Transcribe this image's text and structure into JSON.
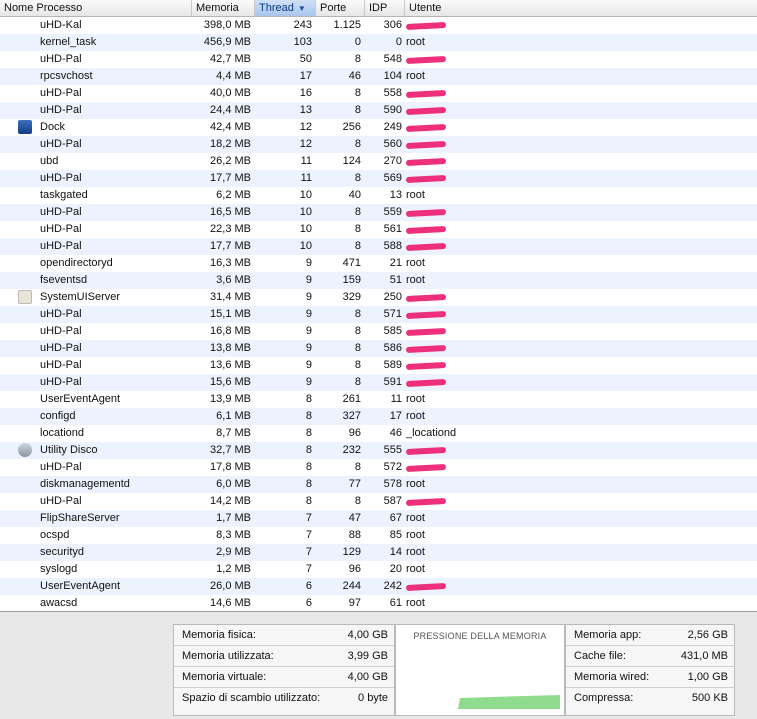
{
  "columns": {
    "name": "Nome Processo",
    "memory": "Memoria",
    "threads": "Thread",
    "ports": "Porte",
    "pid": "IDP",
    "user": "Utente"
  },
  "processes": [
    {
      "name": "uHD-Kal",
      "memory": "398,0 MB",
      "threads": "243",
      "ports": "1.125",
      "pid": "306",
      "user": ""
    },
    {
      "name": "kernel_task",
      "memory": "456,9 MB",
      "threads": "103",
      "ports": "0",
      "pid": "0",
      "user": "root"
    },
    {
      "name": "uHD-Pal",
      "memory": "42,7 MB",
      "threads": "50",
      "ports": "8",
      "pid": "548",
      "user": ""
    },
    {
      "name": "rpcsvchost",
      "memory": "4,4 MB",
      "threads": "17",
      "ports": "46",
      "pid": "104",
      "user": "root"
    },
    {
      "name": "uHD-Pal",
      "memory": "40,0 MB",
      "threads": "16",
      "ports": "8",
      "pid": "558",
      "user": ""
    },
    {
      "name": "uHD-Pal",
      "memory": "24,4 MB",
      "threads": "13",
      "ports": "8",
      "pid": "590",
      "user": ""
    },
    {
      "name": "Dock",
      "memory": "42,4 MB",
      "threads": "12",
      "ports": "256",
      "pid": "249",
      "user": "",
      "icon": "dock-icon"
    },
    {
      "name": "uHD-Pal",
      "memory": "18,2 MB",
      "threads": "12",
      "ports": "8",
      "pid": "560",
      "user": ""
    },
    {
      "name": "ubd",
      "memory": "26,2 MB",
      "threads": "11",
      "ports": "124",
      "pid": "270",
      "user": ""
    },
    {
      "name": "uHD-Pal",
      "memory": "17,7 MB",
      "threads": "11",
      "ports": "8",
      "pid": "569",
      "user": ""
    },
    {
      "name": "taskgated",
      "memory": "6,2 MB",
      "threads": "10",
      "ports": "40",
      "pid": "13",
      "user": "root"
    },
    {
      "name": "uHD-Pal",
      "memory": "16,5 MB",
      "threads": "10",
      "ports": "8",
      "pid": "559",
      "user": ""
    },
    {
      "name": "uHD-Pal",
      "memory": "22,3 MB",
      "threads": "10",
      "ports": "8",
      "pid": "561",
      "user": ""
    },
    {
      "name": "uHD-Pal",
      "memory": "17,7 MB",
      "threads": "10",
      "ports": "8",
      "pid": "588",
      "user": ""
    },
    {
      "name": "opendirectoryd",
      "memory": "16,3 MB",
      "threads": "9",
      "ports": "471",
      "pid": "21",
      "user": "root"
    },
    {
      "name": "fseventsd",
      "memory": "3,6 MB",
      "threads": "9",
      "ports": "159",
      "pid": "51",
      "user": "root"
    },
    {
      "name": "SystemUIServer",
      "memory": "31,4 MB",
      "threads": "9",
      "ports": "329",
      "pid": "250",
      "user": "",
      "icon": "systemuiserver-icon"
    },
    {
      "name": "uHD-Pal",
      "memory": "15,1 MB",
      "threads": "9",
      "ports": "8",
      "pid": "571",
      "user": ""
    },
    {
      "name": "uHD-Pal",
      "memory": "16,8 MB",
      "threads": "9",
      "ports": "8",
      "pid": "585",
      "user": ""
    },
    {
      "name": "uHD-Pal",
      "memory": "13,8 MB",
      "threads": "9",
      "ports": "8",
      "pid": "586",
      "user": ""
    },
    {
      "name": "uHD-Pal",
      "memory": "13,6 MB",
      "threads": "9",
      "ports": "8",
      "pid": "589",
      "user": ""
    },
    {
      "name": "uHD-Pal",
      "memory": "15,6 MB",
      "threads": "9",
      "ports": "8",
      "pid": "591",
      "user": ""
    },
    {
      "name": "UserEventAgent",
      "memory": "13,9 MB",
      "threads": "8",
      "ports": "261",
      "pid": "11",
      "user": "root"
    },
    {
      "name": "configd",
      "memory": "6,1 MB",
      "threads": "8",
      "ports": "327",
      "pid": "17",
      "user": "root"
    },
    {
      "name": "locationd",
      "memory": "8,7 MB",
      "threads": "8",
      "ports": "96",
      "pid": "46",
      "user": "_locationd"
    },
    {
      "name": "Utility Disco",
      "memory": "32,7 MB",
      "threads": "8",
      "ports": "232",
      "pid": "555",
      "user": "",
      "icon": "disk-utility-icon"
    },
    {
      "name": "uHD-Pal",
      "memory": "17,8 MB",
      "threads": "8",
      "ports": "8",
      "pid": "572",
      "user": ""
    },
    {
      "name": "diskmanagementd",
      "memory": "6,0 MB",
      "threads": "8",
      "ports": "77",
      "pid": "578",
      "user": "root"
    },
    {
      "name": "uHD-Pal",
      "memory": "14,2 MB",
      "threads": "8",
      "ports": "8",
      "pid": "587",
      "user": ""
    },
    {
      "name": "FlipShareServer",
      "memory": "1,7 MB",
      "threads": "7",
      "ports": "47",
      "pid": "67",
      "user": "root"
    },
    {
      "name": "ocspd",
      "memory": "8,3 MB",
      "threads": "7",
      "ports": "88",
      "pid": "85",
      "user": "root"
    },
    {
      "name": "securityd",
      "memory": "2,9 MB",
      "threads": "7",
      "ports": "129",
      "pid": "14",
      "user": "root"
    },
    {
      "name": "syslogd",
      "memory": "1,2 MB",
      "threads": "7",
      "ports": "96",
      "pid": "20",
      "user": "root"
    },
    {
      "name": "UserEventAgent",
      "memory": "26,0 MB",
      "threads": "6",
      "ports": "244",
      "pid": "242",
      "user": ""
    },
    {
      "name": "awacsd",
      "memory": "14,6 MB",
      "threads": "6",
      "ports": "97",
      "pid": "61",
      "user": "root"
    }
  ],
  "memory_stats_left": [
    {
      "label": "Memoria fisica:",
      "value": "4,00 GB"
    },
    {
      "label": "Memoria utilizzata:",
      "value": "3,99 GB"
    },
    {
      "label": "Memoria virtuale:",
      "value": "4,00 GB"
    },
    {
      "label": "Spazio di scambio utilizzato:",
      "value": "0 byte"
    }
  ],
  "memory_pressure": {
    "title": "PRESSIONE DELLA MEMORIA",
    "color": "#8fdc8f"
  },
  "memory_stats_right": [
    {
      "label": "Memoria app:",
      "value": "2,56 GB"
    },
    {
      "label": "Cache file:",
      "value": "431,0 MB"
    },
    {
      "label": "Memoria wired:",
      "value": "1,00 GB"
    },
    {
      "label": "Compressa:",
      "value": "500 KB"
    }
  ],
  "colors": {
    "sorted_header": "#a9c6ec",
    "row_alt": "#edf3fe",
    "redaction": "#ee2f7b"
  }
}
